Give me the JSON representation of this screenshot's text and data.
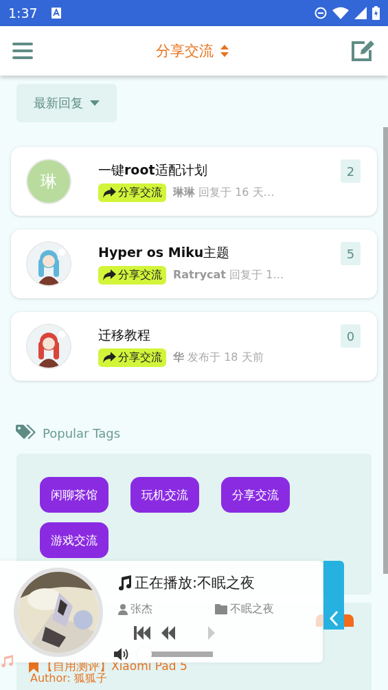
{
  "status_bar": {
    "time": "1:37"
  },
  "header": {
    "title": "分享交流"
  },
  "sort": {
    "label": "最新回复"
  },
  "posts": [
    {
      "avatar": {
        "kind": "letter",
        "text": "琳",
        "color": "#b9dc9e"
      },
      "title": "一键**root**适配计划",
      "tag": "分享交流",
      "meta": "**琳琳** 回复于 16 天…",
      "count": "2"
    },
    {
      "title": "**Hyper os Miku**主题",
      "tag": "分享交流",
      "meta": "**Ratrycat** 回复于 1…",
      "count": "5"
    },
    {
      "title": "迁移教程",
      "tag": "分享交流",
      "meta": "**华** 发布于 18 天前",
      "count": "0"
    }
  ],
  "tags_section": {
    "title": "Popular Tags",
    "tags": [
      "闲聊茶馆",
      "玩机交流",
      "分享交流",
      "游戏交流"
    ]
  },
  "recent_post": {
    "title": "【自用测评】Xiaomi Pad 5",
    "author": "Author: 狐狐子"
  },
  "player": {
    "now_playing": "正在播放:不眠之夜",
    "artist": "张杰",
    "album": "不眠之夜",
    "volume": {
      "level": 0
    }
  }
}
